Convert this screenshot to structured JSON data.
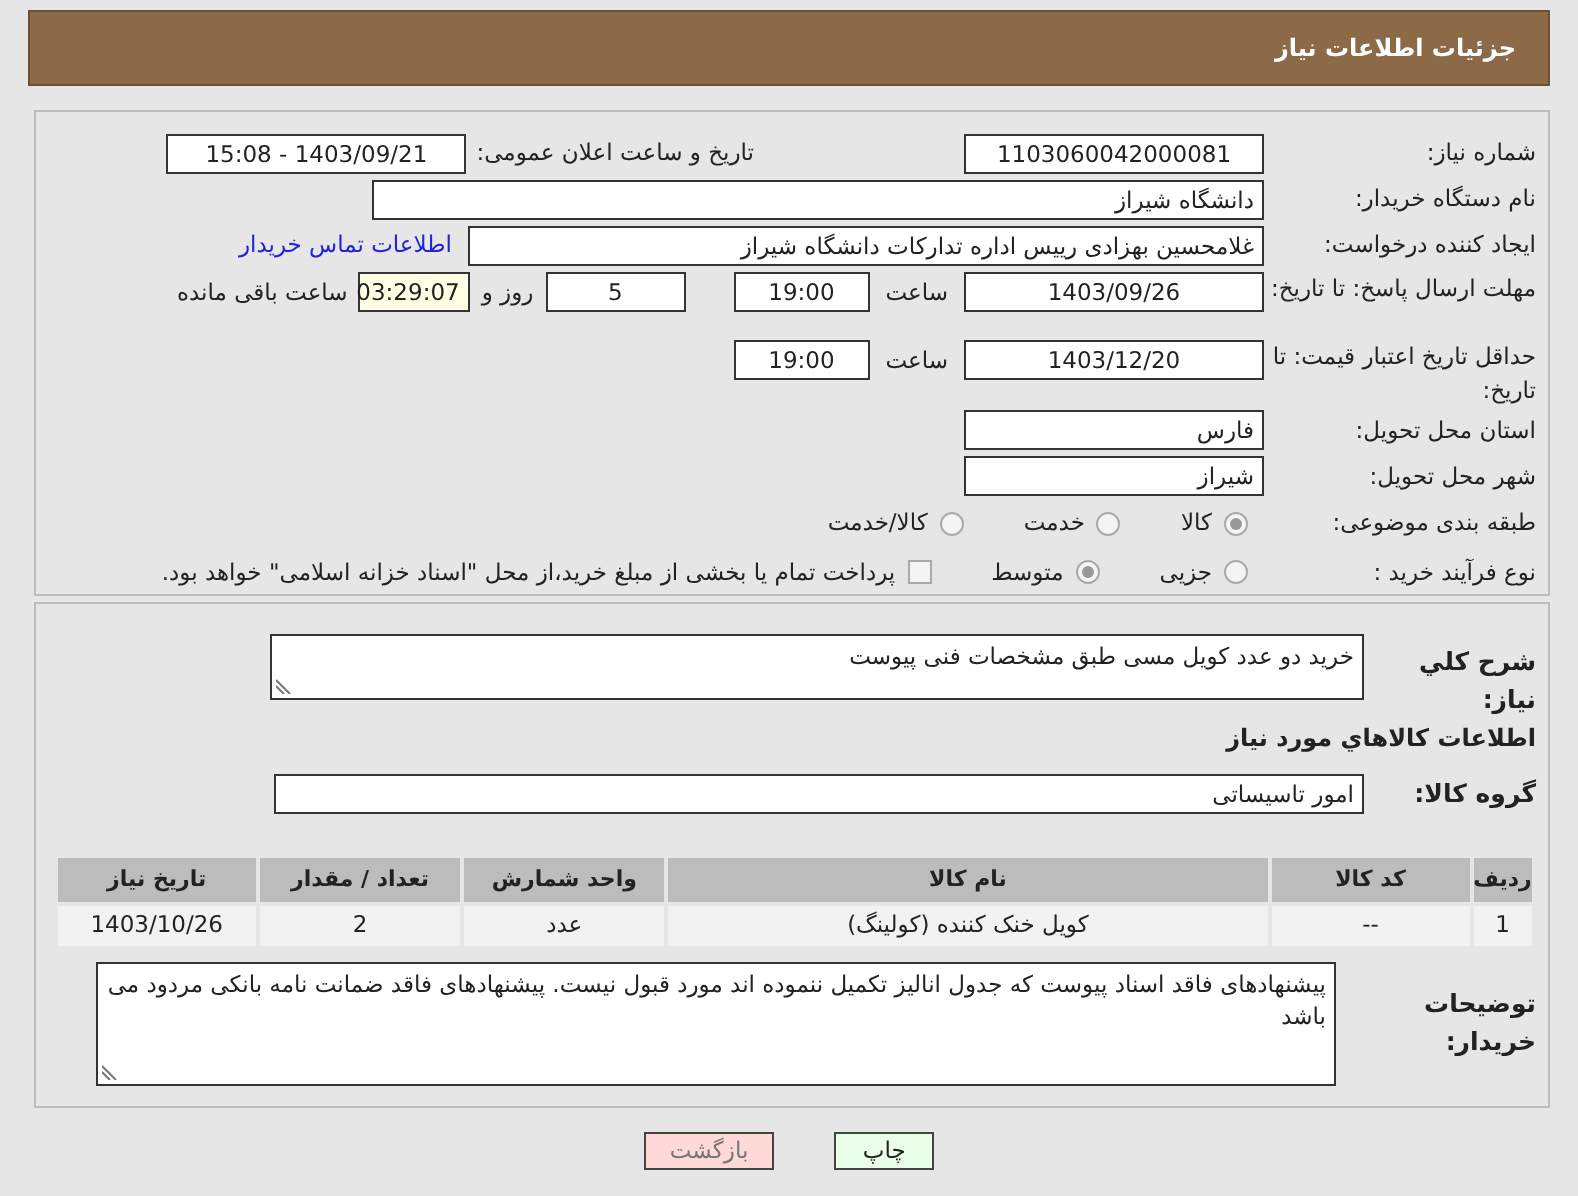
{
  "header": {
    "title": "جزئیات اطلاعات نیاز"
  },
  "need_number": {
    "label": "شماره نیاز:",
    "value": "1103060042000081"
  },
  "announce": {
    "label": "تاریخ و ساعت اعلان عمومی:",
    "value": "1403/09/21 - 15:08"
  },
  "buyer_org": {
    "label": "نام دستگاه خریدار:",
    "value": "دانشگاه شیراز"
  },
  "requester": {
    "label": "ایجاد کننده درخواست:",
    "value": "غلامحسین بهزادی رییس اداره تدارکات دانشگاه شیراز",
    "link": "اطلاعات تماس خریدار"
  },
  "deadline": {
    "label": "مهلت ارسال پاسخ: تا تاریخ:",
    "date": "1403/09/26",
    "time_label": "ساعت",
    "time": "19:00",
    "days": "5",
    "days_label": "روز و",
    "remaining": "03:29:07",
    "remaining_label": "ساعت باقی مانده"
  },
  "validity": {
    "label": "حداقل تاریخ اعتبار قیمت: تا تاریخ:",
    "date": "1403/12/20",
    "time_label": "ساعت",
    "time": "19:00"
  },
  "province": {
    "label": "استان محل تحویل:",
    "value": "فارس"
  },
  "city": {
    "label": "شهر محل تحویل:",
    "value": "شیراز"
  },
  "category": {
    "label": "طبقه بندی موضوعی:",
    "options": [
      {
        "label": "کالا",
        "selected": true
      },
      {
        "label": "خدمت",
        "selected": false
      },
      {
        "label": "کالا/خدمت",
        "selected": false
      }
    ]
  },
  "process": {
    "label": "نوع فرآیند خرید :",
    "options": [
      {
        "label": "جزیی",
        "selected": false
      },
      {
        "label": "متوسط",
        "selected": true
      }
    ],
    "payment": {
      "label": "پرداخت تمام یا بخشی از مبلغ خرید،از محل \"اسناد خزانه اسلامی\" خواهد بود.",
      "checked": false
    }
  },
  "description": {
    "label": "شرح کلي نياز:",
    "value": "خرید دو عدد کویل مسی طبق مشخصات فنی پیوست"
  },
  "goods_title": "اطلاعات کالاهاي مورد نياز",
  "goods_group": {
    "label": "گروه کالا:",
    "value": "امور تاسیساتی"
  },
  "table": {
    "columns": [
      "ردیف",
      "کد کالا",
      "نام کالا",
      "واحد شمارش",
      "تعداد / مقدار",
      "تاریخ نیاز"
    ],
    "rows": [
      [
        "1",
        "--",
        "کویل خنک کننده (کولینگ)",
        "عدد",
        "2",
        "1403/10/26"
      ]
    ]
  },
  "buyer_notes": {
    "label": "توضیحات خریدار:",
    "value": "پیشنهادهای فاقد اسناد پیوست که جدول انالیز تکمیل ننموده اند مورد قبول نیست. پیشنهادهای فاقد ضمانت نامه بانکی مردود می باشد"
  },
  "buttons": [
    {
      "label": "چاپ",
      "kind": "print"
    },
    {
      "label": "بازگشت",
      "kind": "back"
    }
  ]
}
